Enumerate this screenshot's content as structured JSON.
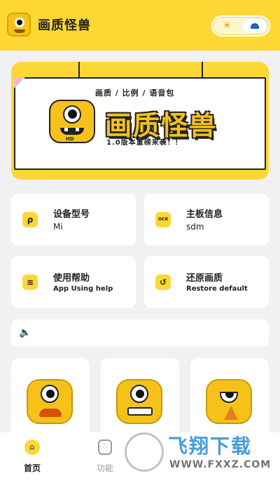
{
  "header": {
    "title": "画质怪兽"
  },
  "banner": {
    "tags": "画质 / 比例 / 语音包",
    "title": "画质怪兽",
    "subtitle": "1.0版本重磅来袭！！",
    "badge": "HD"
  },
  "cards": {
    "device_model": {
      "label": "设备型号",
      "value": "Mi",
      "icon": "pen-icon"
    },
    "board_info": {
      "label": "主板信息",
      "value": "sdm",
      "icon": "ocr-icon",
      "icon_text": "OCR"
    },
    "help": {
      "label": "使用帮助",
      "value": "App Using help",
      "icon": "layers-icon"
    },
    "restore": {
      "label": "还原画质",
      "value": "Restore default",
      "icon": "restore-icon"
    }
  },
  "tabbar": {
    "home": "首页",
    "functions": "功能"
  },
  "watermark": {
    "text": "飞翔下载",
    "url": "WWW.FXXZ.COM"
  },
  "colors": {
    "accent": "#fdd835",
    "mascot": "#f6c21a",
    "background": "#f1f1f3"
  }
}
